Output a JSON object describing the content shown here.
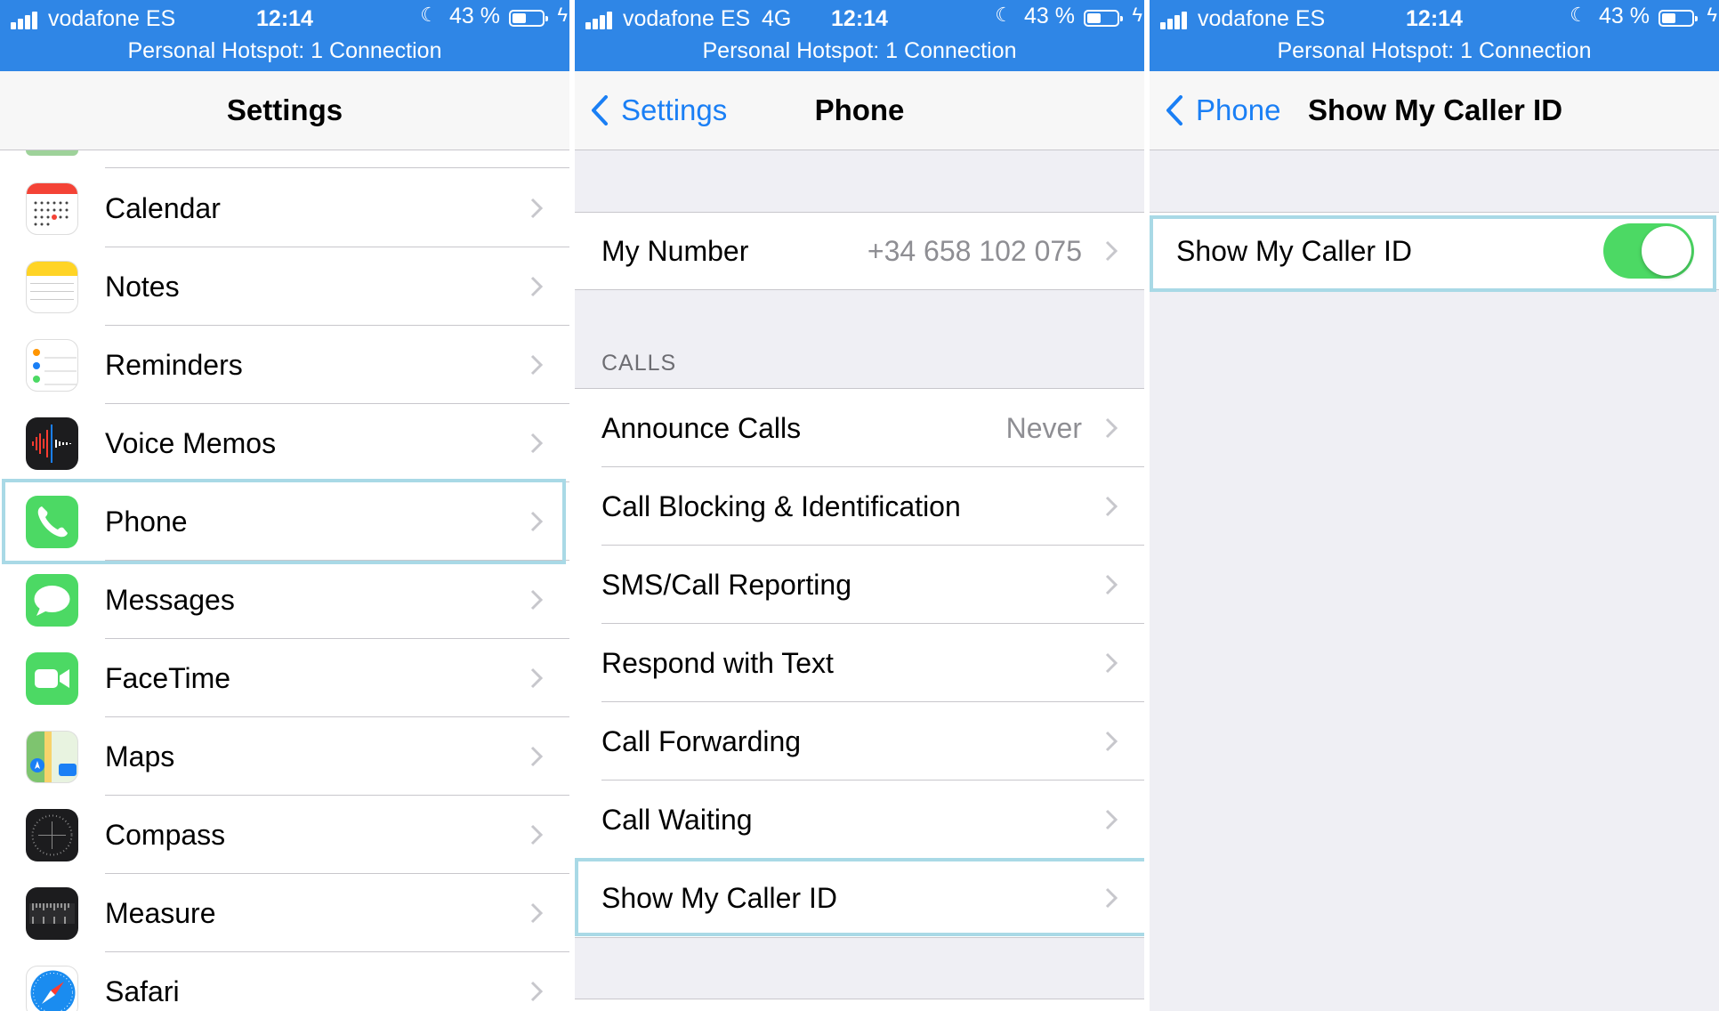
{
  "status_bar": {
    "carrier": "vodafone ES",
    "network": "4G",
    "time": "12:14",
    "battery_percent": "43 %",
    "battery_level": 0.43,
    "hotspot": "Personal Hotspot: 1 Connection",
    "background_color": "#2f86e6"
  },
  "settings_screen": {
    "title": "Settings",
    "items": [
      {
        "label": "Calendar",
        "icon": "calendar-icon"
      },
      {
        "label": "Notes",
        "icon": "notes-icon"
      },
      {
        "label": "Reminders",
        "icon": "reminders-icon"
      },
      {
        "label": "Voice Memos",
        "icon": "voice-memos-icon"
      },
      {
        "label": "Phone",
        "icon": "phone-icon"
      },
      {
        "label": "Messages",
        "icon": "messages-icon"
      },
      {
        "label": "FaceTime",
        "icon": "facetime-icon"
      },
      {
        "label": "Maps",
        "icon": "maps-icon"
      },
      {
        "label": "Compass",
        "icon": "compass-icon"
      },
      {
        "label": "Measure",
        "icon": "measure-icon"
      },
      {
        "label": "Safari",
        "icon": "safari-icon"
      }
    ]
  },
  "phone_screen": {
    "back_label": "Settings",
    "title": "Phone",
    "my_number": {
      "label": "My Number",
      "value": "+34 658 102 075"
    },
    "calls_header": "CALLS",
    "calls": [
      {
        "label": "Announce Calls",
        "value": "Never"
      },
      {
        "label": "Call Blocking & Identification",
        "value": ""
      },
      {
        "label": "SMS/Call Reporting",
        "value": ""
      },
      {
        "label": "Respond with Text",
        "value": ""
      },
      {
        "label": "Call Forwarding",
        "value": ""
      },
      {
        "label": "Call Waiting",
        "value": ""
      },
      {
        "label": "Show My Caller ID",
        "value": ""
      }
    ]
  },
  "caller_id_screen": {
    "back_label": "Phone",
    "title": "Show My Caller ID",
    "toggle_label": "Show My Caller ID",
    "toggle_on": true,
    "toggle_color": "#4cd964"
  },
  "colors": {
    "accent": "#1a7ff5",
    "highlight": "#a9d9e6"
  }
}
